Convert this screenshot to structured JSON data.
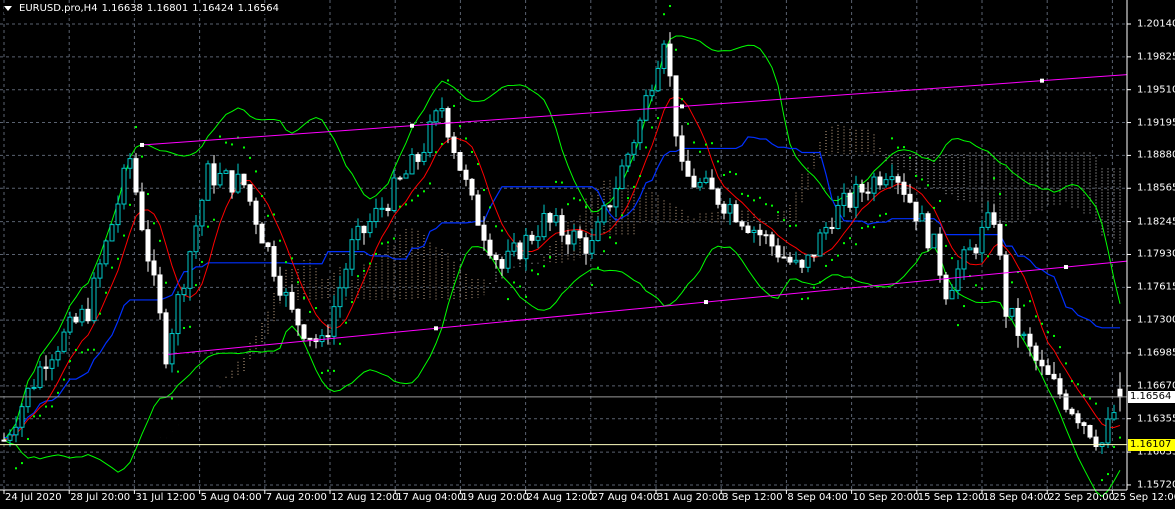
{
  "header": {
    "symbol": "EURUSD.pro,H4",
    "open": "1.16638",
    "high": "1.16801",
    "low": "1.16424",
    "close": "1.16564"
  },
  "price_axis": [
    "1.20140",
    "1.19825",
    "1.19510",
    "1.19195",
    "1.18880",
    "1.18565",
    "1.18245",
    "1.17930",
    "1.17615",
    "1.17300",
    "1.16985",
    "1.16670",
    "1.16355",
    "1.16035",
    "1.15720"
  ],
  "time_axis": [
    "24 Jul 2020",
    "28 Jul 20:00",
    "31 Jul 12:00",
    "5 Aug 04:00",
    "7 Aug 20:00",
    "12 Aug 12:00",
    "17 Aug 04:00",
    "19 Aug 20:00",
    "24 Aug 12:00",
    "27 Aug 04:00",
    "31 Aug 20:00",
    "3 Sep 12:00",
    "8 Sep 04:00",
    "10 Sep 20:00",
    "15 Sep 12:00",
    "18 Sep 04:00",
    "22 Sep 20:00",
    "25 Sep 12:00"
  ],
  "bid_tag": "1.16564",
  "level_tag": "1.16107",
  "colors": {
    "bg": "#000000",
    "grid": "#5a6270",
    "bull": "#00c8c8",
    "bear": "#ffffff",
    "ma": "#ff0000",
    "kijun": "#0030ff",
    "bands": "#00ff00",
    "sar": "#00ff00",
    "channel": "#ff00ff",
    "level": "#ffff00"
  },
  "chart_data": {
    "type": "candlestick",
    "symbol": "EURUSD.pro",
    "timeframe": "H4",
    "ylim": [
      1.1572,
      1.2014
    ],
    "price_path": [
      [
        0,
        1.1615
      ],
      [
        7,
        1.1695
      ],
      [
        14,
        1.174
      ],
      [
        21,
        1.1885
      ],
      [
        27,
        1.17
      ],
      [
        34,
        1.187
      ],
      [
        40,
        1.186
      ],
      [
        48,
        1.1735
      ],
      [
        53,
        1.1705
      ],
      [
        58,
        1.18
      ],
      [
        69,
        1.1885
      ],
      [
        73,
        1.1935
      ],
      [
        78,
        1.184
      ],
      [
        83,
        1.178
      ],
      [
        90,
        1.1825
      ],
      [
        98,
        1.18
      ],
      [
        106,
        1.192
      ],
      [
        110,
        1.2005
      ],
      [
        113,
        1.187
      ],
      [
        121,
        1.184
      ],
      [
        133,
        1.1775
      ],
      [
        138,
        1.183
      ],
      [
        148,
        1.188
      ],
      [
        155,
        1.18
      ],
      [
        157,
        1.176
      ],
      [
        165,
        1.183
      ],
      [
        167,
        1.174
      ],
      [
        173,
        1.168
      ],
      [
        179,
        1.164
      ],
      [
        183,
        1.1612
      ],
      [
        186,
        1.1656
      ]
    ],
    "channel_upper": [
      [
        23,
        1.1898
      ],
      [
        186,
        1.1965
      ]
    ],
    "channel_lower": [
      [
        27,
        1.1697
      ],
      [
        186,
        1.1786
      ]
    ],
    "bid": 1.16564,
    "level": 1.16107
  }
}
